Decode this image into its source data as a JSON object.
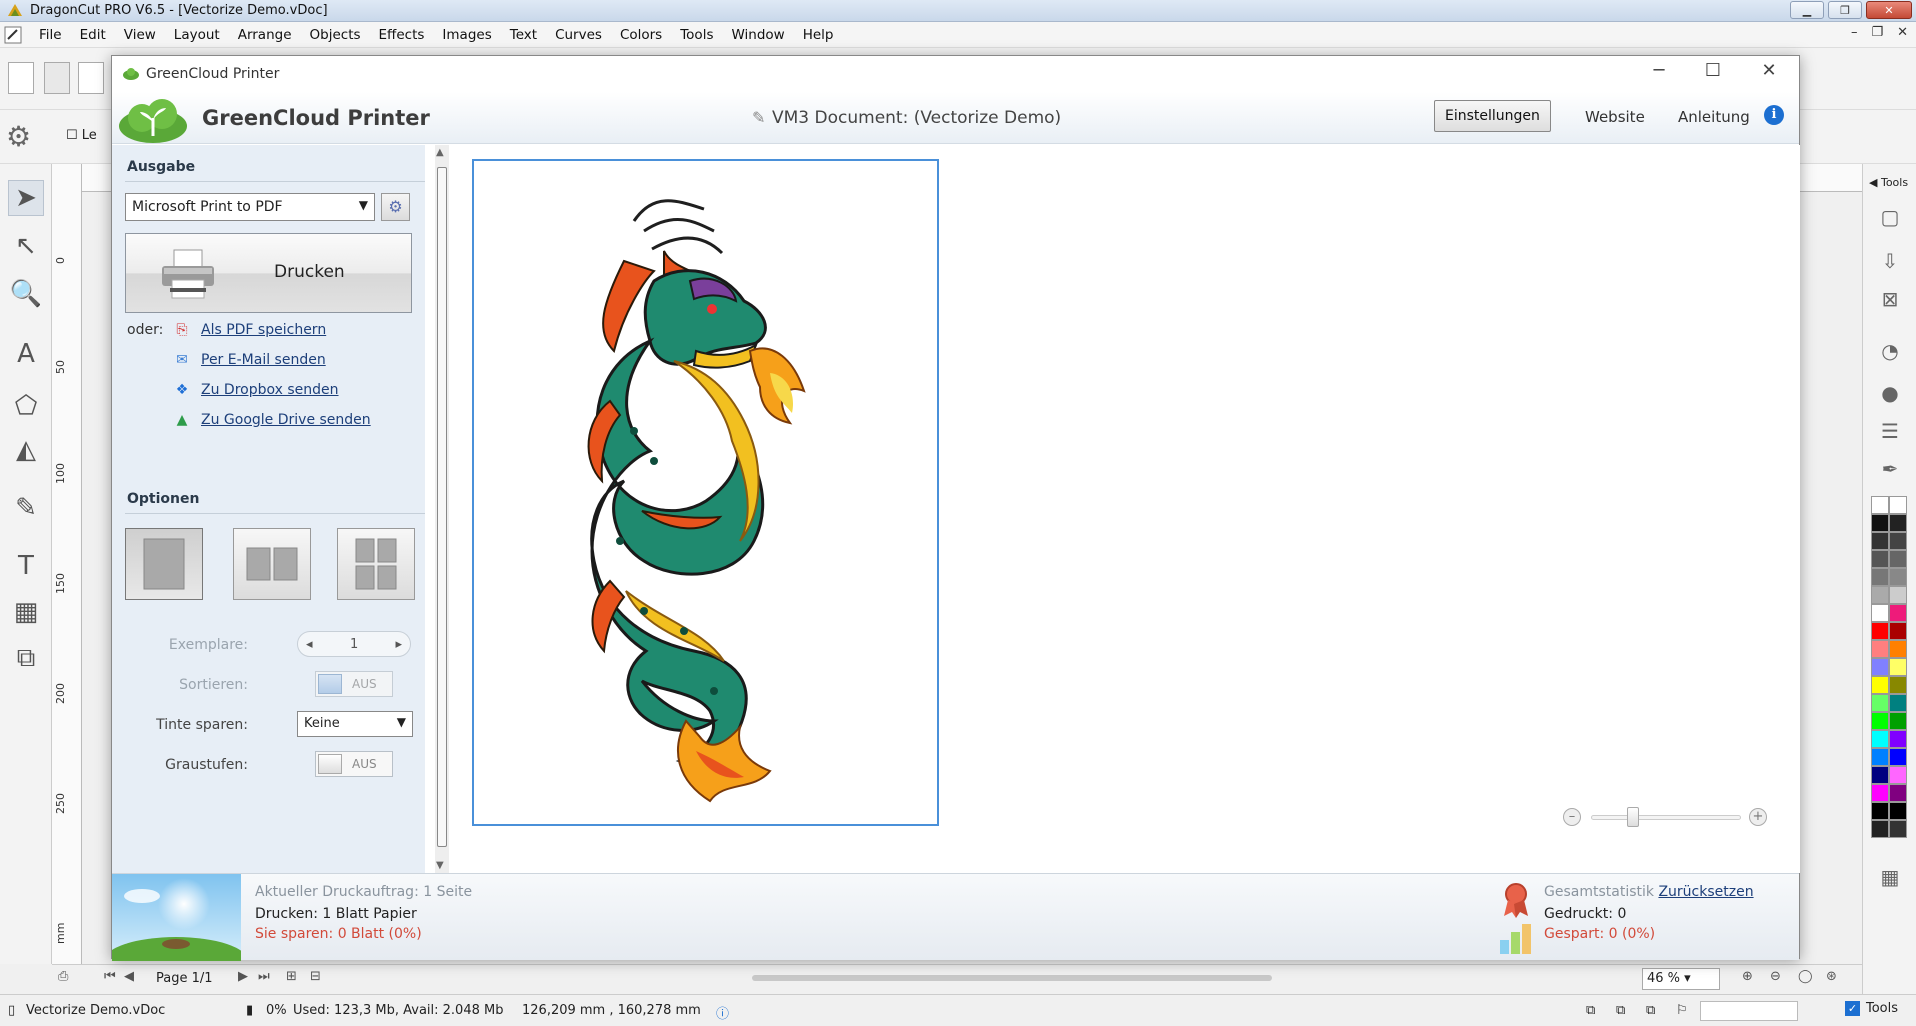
{
  "app": {
    "title": "DragonCut PRO V6.5 - [Vectorize Demo.vDoc]",
    "menu": [
      "File",
      "Edit",
      "View",
      "Layout",
      "Arrange",
      "Objects",
      "Effects",
      "Images",
      "Text",
      "Curves",
      "Colors",
      "Tools",
      "Window",
      "Help"
    ],
    "propbar_checkbox_label": "Le",
    "ruler_v_ticks": [
      "0",
      "50",
      "100",
      "150",
      "200",
      "250",
      "mm"
    ],
    "page_nav_label": "Page 1/1",
    "zoom_value": "46 %",
    "right_panel_tab": "Tools",
    "ruler_unit": "mm"
  },
  "status": {
    "file": "Vectorize Demo.vDoc",
    "progress": "0%",
    "memory": "Used: 123,3 Mb, Avail: 2.048 Mb",
    "coords": "126,209 mm , 160,278 mm",
    "tools_label": "Tools"
  },
  "palette": [
    "#ffffff",
    "#ffffff",
    "#111111",
    "#222222",
    "#333333",
    "#444444",
    "#555555",
    "#666666",
    "#777777",
    "#888888",
    "#aaaaaa",
    "#cccccc",
    "#ffffff",
    "#ee1b7a",
    "#ff0000",
    "#aa0000",
    "#ff7f7f",
    "#ff8000",
    "#8080ff",
    "#ffff66",
    "#ffff00",
    "#888800",
    "#66ff66",
    "#008080",
    "#00ff00",
    "#00a000",
    "#00ffff",
    "#8000ff",
    "#0080ff",
    "#0000ff",
    "#000080",
    "#ff66ff",
    "#ff00ff",
    "#800080",
    "#000000",
    "#000000",
    "#222222",
    "#333333"
  ],
  "dialog": {
    "title": "GreenCloud Printer",
    "brand": "GreenCloud Printer",
    "document": "VM3 Document: (Vectorize Demo)",
    "settings_btn": "Einstellungen",
    "website_link": "Website",
    "guide_link": "Anleitung",
    "output_section": "Ausgabe",
    "printer": "Microsoft Print to PDF",
    "print_btn": "Drucken",
    "or_label": "oder:",
    "alternatives": [
      "Als PDF speichern",
      "Per E-Mail senden",
      "Zu Dropbox senden",
      "Zu Google Drive senden"
    ],
    "options_section": "Optionen",
    "copies_label": "Exemplare:",
    "copies_value": "1",
    "collate_label": "Sortieren:",
    "collate_value": "AUS",
    "ink_label": "Tinte sparen:",
    "ink_value": "Keine",
    "grayscale_label": "Graustufen:",
    "grayscale_value": "AUS",
    "job_line": "Aktueller Druckauftrag: 1 Seite",
    "print_line": "Drucken: 1 Blatt Papier",
    "save_line": "Sie sparen: 0 Blatt (0%)",
    "stats_title": "Gesamtstatistik",
    "reset_link": "Zurücksetzen",
    "printed_line": "Gedruckt: 0",
    "saved_line": "Gespart: 0 (0%)"
  },
  "colors": {
    "accent": "#1c6fd1",
    "link": "#1d3f7a",
    "savings_red": "#d24a3a",
    "dragon_green": "#1f8a6f",
    "dragon_orange": "#e8531d"
  }
}
